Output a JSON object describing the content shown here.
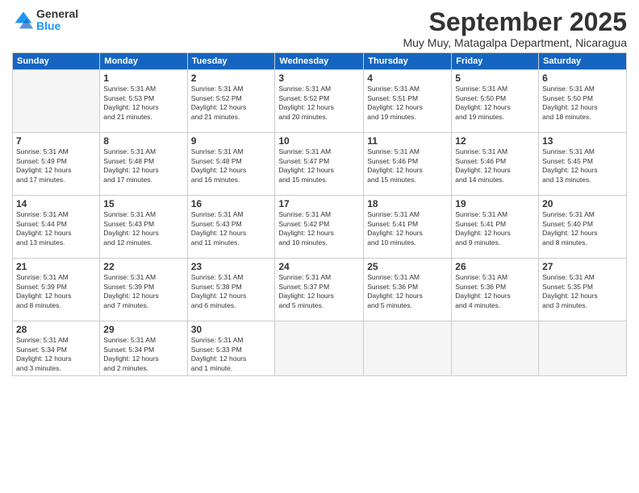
{
  "logo": {
    "general": "General",
    "blue": "Blue"
  },
  "title": "September 2025",
  "location": "Muy Muy, Matagalpa Department, Nicaragua",
  "days_of_week": [
    "Sunday",
    "Monday",
    "Tuesday",
    "Wednesday",
    "Thursday",
    "Friday",
    "Saturday"
  ],
  "weeks": [
    [
      {
        "day": "",
        "info": ""
      },
      {
        "day": "1",
        "info": "Sunrise: 5:31 AM\nSunset: 5:53 PM\nDaylight: 12 hours\nand 21 minutes."
      },
      {
        "day": "2",
        "info": "Sunrise: 5:31 AM\nSunset: 5:52 PM\nDaylight: 12 hours\nand 21 minutes."
      },
      {
        "day": "3",
        "info": "Sunrise: 5:31 AM\nSunset: 5:52 PM\nDaylight: 12 hours\nand 20 minutes."
      },
      {
        "day": "4",
        "info": "Sunrise: 5:31 AM\nSunset: 5:51 PM\nDaylight: 12 hours\nand 19 minutes."
      },
      {
        "day": "5",
        "info": "Sunrise: 5:31 AM\nSunset: 5:50 PM\nDaylight: 12 hours\nand 19 minutes."
      },
      {
        "day": "6",
        "info": "Sunrise: 5:31 AM\nSunset: 5:50 PM\nDaylight: 12 hours\nand 18 minutes."
      }
    ],
    [
      {
        "day": "7",
        "info": "Sunrise: 5:31 AM\nSunset: 5:49 PM\nDaylight: 12 hours\nand 17 minutes."
      },
      {
        "day": "8",
        "info": "Sunrise: 5:31 AM\nSunset: 5:48 PM\nDaylight: 12 hours\nand 17 minutes."
      },
      {
        "day": "9",
        "info": "Sunrise: 5:31 AM\nSunset: 5:48 PM\nDaylight: 12 hours\nand 16 minutes."
      },
      {
        "day": "10",
        "info": "Sunrise: 5:31 AM\nSunset: 5:47 PM\nDaylight: 12 hours\nand 15 minutes."
      },
      {
        "day": "11",
        "info": "Sunrise: 5:31 AM\nSunset: 5:46 PM\nDaylight: 12 hours\nand 15 minutes."
      },
      {
        "day": "12",
        "info": "Sunrise: 5:31 AM\nSunset: 5:46 PM\nDaylight: 12 hours\nand 14 minutes."
      },
      {
        "day": "13",
        "info": "Sunrise: 5:31 AM\nSunset: 5:45 PM\nDaylight: 12 hours\nand 13 minutes."
      }
    ],
    [
      {
        "day": "14",
        "info": "Sunrise: 5:31 AM\nSunset: 5:44 PM\nDaylight: 12 hours\nand 13 minutes."
      },
      {
        "day": "15",
        "info": "Sunrise: 5:31 AM\nSunset: 5:43 PM\nDaylight: 12 hours\nand 12 minutes."
      },
      {
        "day": "16",
        "info": "Sunrise: 5:31 AM\nSunset: 5:43 PM\nDaylight: 12 hours\nand 11 minutes."
      },
      {
        "day": "17",
        "info": "Sunrise: 5:31 AM\nSunset: 5:42 PM\nDaylight: 12 hours\nand 10 minutes."
      },
      {
        "day": "18",
        "info": "Sunrise: 5:31 AM\nSunset: 5:41 PM\nDaylight: 12 hours\nand 10 minutes."
      },
      {
        "day": "19",
        "info": "Sunrise: 5:31 AM\nSunset: 5:41 PM\nDaylight: 12 hours\nand 9 minutes."
      },
      {
        "day": "20",
        "info": "Sunrise: 5:31 AM\nSunset: 5:40 PM\nDaylight: 12 hours\nand 8 minutes."
      }
    ],
    [
      {
        "day": "21",
        "info": "Sunrise: 5:31 AM\nSunset: 5:39 PM\nDaylight: 12 hours\nand 8 minutes."
      },
      {
        "day": "22",
        "info": "Sunrise: 5:31 AM\nSunset: 5:39 PM\nDaylight: 12 hours\nand 7 minutes."
      },
      {
        "day": "23",
        "info": "Sunrise: 5:31 AM\nSunset: 5:38 PM\nDaylight: 12 hours\nand 6 minutes."
      },
      {
        "day": "24",
        "info": "Sunrise: 5:31 AM\nSunset: 5:37 PM\nDaylight: 12 hours\nand 5 minutes."
      },
      {
        "day": "25",
        "info": "Sunrise: 5:31 AM\nSunset: 5:36 PM\nDaylight: 12 hours\nand 5 minutes."
      },
      {
        "day": "26",
        "info": "Sunrise: 5:31 AM\nSunset: 5:36 PM\nDaylight: 12 hours\nand 4 minutes."
      },
      {
        "day": "27",
        "info": "Sunrise: 5:31 AM\nSunset: 5:35 PM\nDaylight: 12 hours\nand 3 minutes."
      }
    ],
    [
      {
        "day": "28",
        "info": "Sunrise: 5:31 AM\nSunset: 5:34 PM\nDaylight: 12 hours\nand 3 minutes."
      },
      {
        "day": "29",
        "info": "Sunrise: 5:31 AM\nSunset: 5:34 PM\nDaylight: 12 hours\nand 2 minutes."
      },
      {
        "day": "30",
        "info": "Sunrise: 5:31 AM\nSunset: 5:33 PM\nDaylight: 12 hours\nand 1 minute."
      },
      {
        "day": "",
        "info": ""
      },
      {
        "day": "",
        "info": ""
      },
      {
        "day": "",
        "info": ""
      },
      {
        "day": "",
        "info": ""
      }
    ]
  ]
}
